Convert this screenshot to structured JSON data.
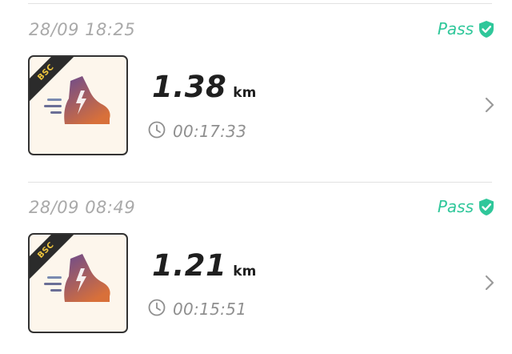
{
  "activities": [
    {
      "datetime": "28/09 18:25",
      "status": "Pass",
      "badge": "BSC",
      "distance": "1.38",
      "unit": "km",
      "duration": "00:17:33"
    },
    {
      "datetime": "28/09 08:49",
      "status": "Pass",
      "badge": "BSC",
      "distance": "1.21",
      "unit": "km",
      "duration": "00:15:51"
    }
  ],
  "colors": {
    "pass": "#2fc79a",
    "badge_text": "#f0c63d",
    "shoe_top": "#6a4a8e",
    "shoe_bottom": "#d8703a"
  },
  "icons": [
    "shield-check-icon",
    "running-shoe-icon",
    "clock-icon",
    "chevron-right-icon"
  ]
}
